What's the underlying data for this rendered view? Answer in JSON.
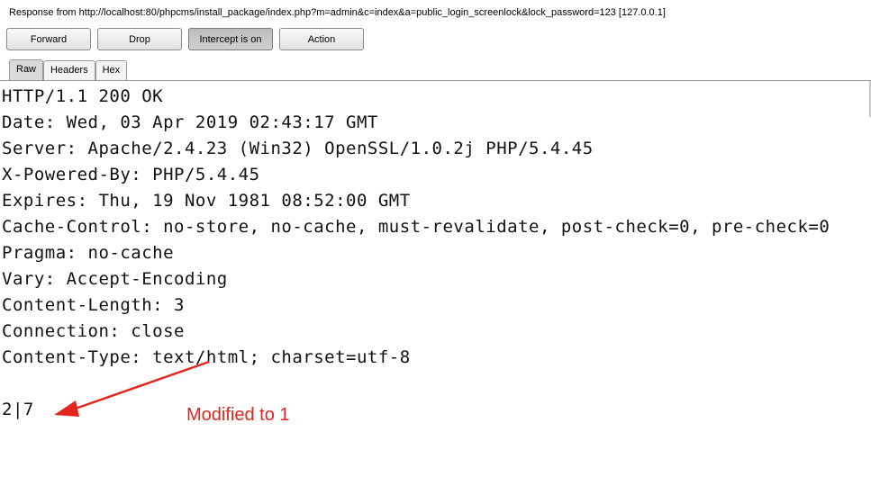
{
  "info_bar": {
    "text": "Response from http://localhost:80/phpcms/install_package/index.php?m=admin&c=index&a=public_login_screenlock&lock_password=123  [127.0.0.1]"
  },
  "toolbar": {
    "forward_label": "Forward",
    "drop_label": "Drop",
    "intercept_label": "Intercept is on",
    "action_label": "Action"
  },
  "tabs": [
    {
      "label": "Raw",
      "active": true
    },
    {
      "label": "Headers",
      "active": false
    },
    {
      "label": "Hex",
      "active": false
    }
  ],
  "response": {
    "lines": [
      "HTTP/1.1 200 OK",
      "Date: Wed, 03 Apr 2019 02:43:17 GMT",
      "Server: Apache/2.4.23 (Win32) OpenSSL/1.0.2j PHP/5.4.45",
      "X-Powered-By: PHP/5.4.45",
      "Expires: Thu, 19 Nov 1981 08:52:00 GMT",
      "Cache-Control: no-store, no-cache, must-revalidate, post-check=0, pre-check=0",
      "Pragma: no-cache",
      "Vary: Accept-Encoding",
      "Content-Length: 3",
      "Connection: close",
      "Content-Type: text/html; charset=utf-8"
    ],
    "body": "2|7"
  },
  "annotation": {
    "text": "Modified to 1",
    "color": "#e2261d"
  },
  "icons": {
    "annotation_arrow": "arrow-icon"
  }
}
